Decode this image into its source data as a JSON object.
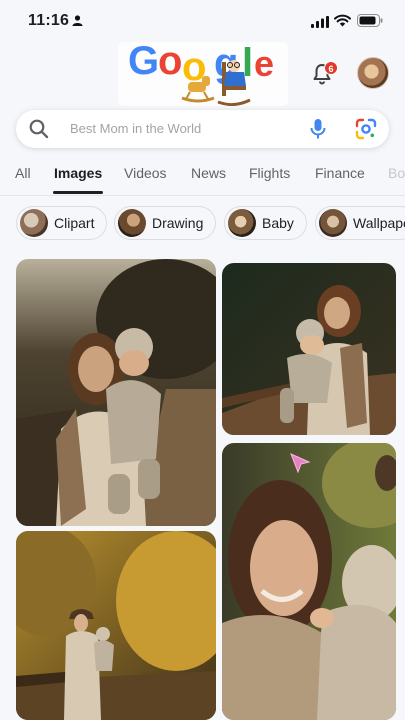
{
  "status_bar": {
    "time": "11:16"
  },
  "header": {
    "notifications_count": "6"
  },
  "search": {
    "query": "Best Mom in the World"
  },
  "tabs": [
    {
      "label": "All"
    },
    {
      "label": "Images"
    },
    {
      "label": "Videos"
    },
    {
      "label": "News"
    },
    {
      "label": "Flights"
    },
    {
      "label": "Finance"
    },
    {
      "label": "Bo"
    }
  ],
  "chips": [
    {
      "label": "Clipart"
    },
    {
      "label": "Drawing"
    },
    {
      "label": "Baby"
    },
    {
      "label": "Wallpaper"
    }
  ],
  "logo_letters": [
    "G",
    "o",
    "o",
    "g",
    "l",
    "e"
  ],
  "colors": {
    "blue": "#4285f4",
    "red": "#ea4335",
    "yellow": "#fbbc05",
    "green": "#34a853"
  }
}
